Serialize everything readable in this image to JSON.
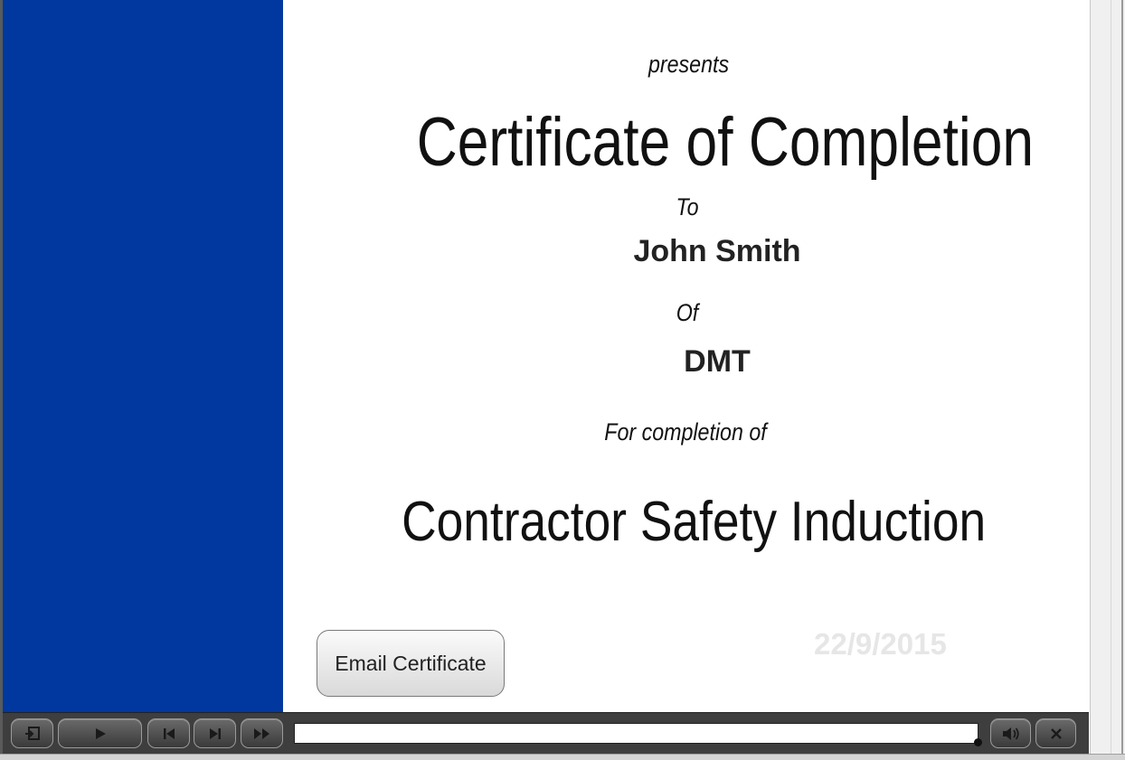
{
  "certificate": {
    "presents": "presents",
    "title": "Certificate of Completion",
    "to_label": "To",
    "recipient": "John Smith",
    "of_label": "Of",
    "organization": "DMT",
    "for_label": "For completion of",
    "course": "Contractor Safety Induction",
    "date": "22/9/2015",
    "email_button": "Email Certificate"
  },
  "colors": {
    "side_panel": "#0038a0",
    "date_text": "#e6e6e6",
    "playbar": "#3e3e3e"
  },
  "playbar": {
    "progress": 1.0,
    "icons": [
      "exit-icon",
      "play-icon",
      "previous-icon",
      "next-icon",
      "fast-forward-icon",
      "volume-icon",
      "close-icon"
    ]
  }
}
